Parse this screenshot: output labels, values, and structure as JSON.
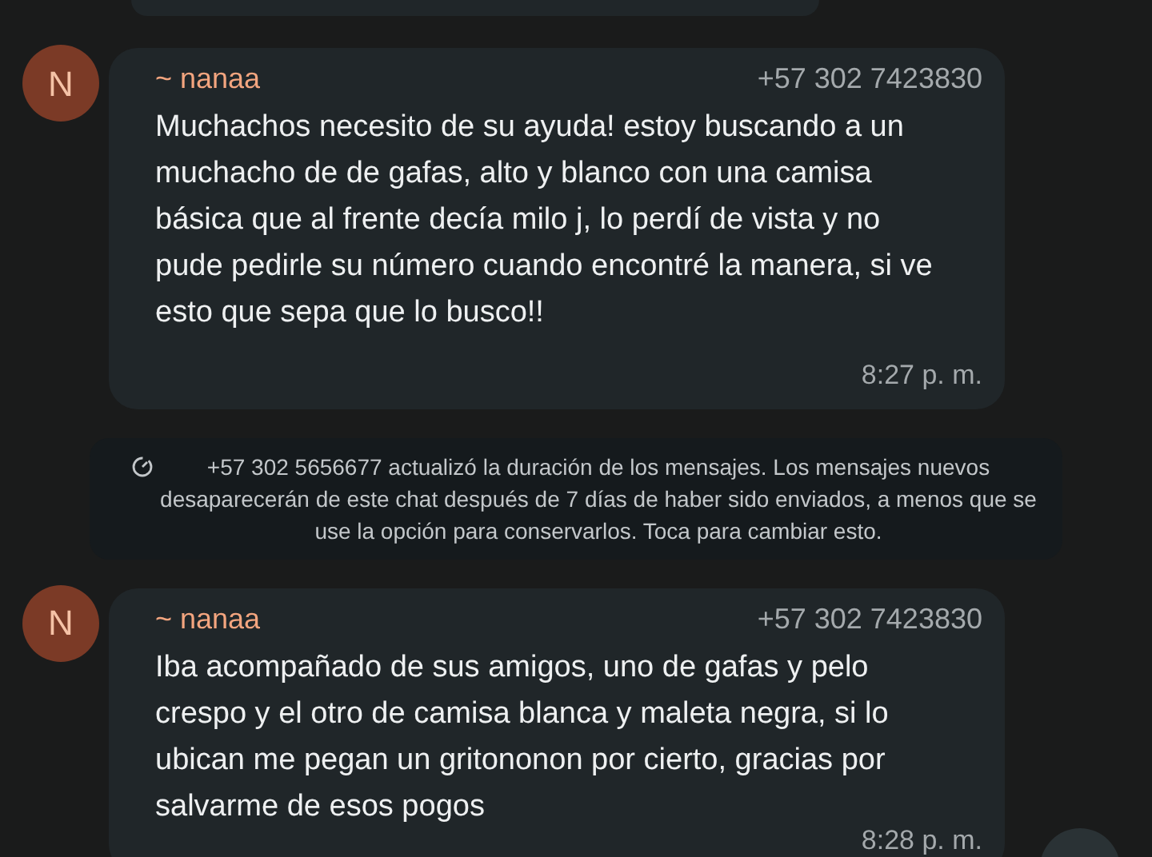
{
  "messages": [
    {
      "kind": "message",
      "avatar": "N",
      "sender": "~ nanaa",
      "phone": "+57 302 7423830",
      "text": "Muchachos necesito de su ayuda!  estoy buscando a un muchacho de de gafas, alto y blanco con una camisa básica que al frente decía milo j, lo perdí de vista y no pude pedirle su número cuando encontré la manera, si ve esto que sepa que lo busco!!",
      "time": "8:27 p. m."
    },
    {
      "kind": "system",
      "text": "+57 302 5656677 actualizó la duración de los mensajes. Los mensajes nuevos desaparecerán de este chat después de 7 días de haber sido enviados, a menos que se use la opción para conservarlos. Toca para cambiar esto."
    },
    {
      "kind": "message",
      "avatar": "N",
      "sender": "~ nanaa",
      "phone": "+57 302 7423830",
      "text": "Iba acompañado de sus amigos, uno de gafas y pelo crespo y el otro de camisa blanca y maleta negra, si lo ubican me pegan un gritononon por cierto, gracias por salvarme de esos pogos",
      "time": "8:28 p. m."
    }
  ]
}
